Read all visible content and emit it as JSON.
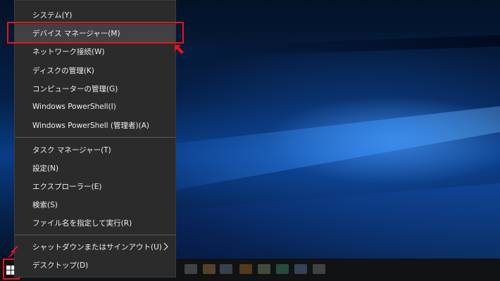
{
  "colors": {
    "menu_background": "#2b2b2b",
    "menu_text": "#f0f0f0",
    "highlight_red": "#e8141c",
    "taskbar": "#101214"
  },
  "context_menu": {
    "items": [
      {
        "label": "システム(Y)"
      },
      {
        "label": "デバイス マネージャー(M)",
        "selected": true
      },
      {
        "label": "ネットワーク接続(W)"
      },
      {
        "label": "ディスクの管理(K)"
      },
      {
        "label": "コンピューターの管理(G)"
      },
      {
        "label": "Windows PowerShell(I)"
      },
      {
        "label": "Windows PowerShell (管理者)(A)"
      },
      {
        "label": "タスク マネージャー(T)"
      },
      {
        "label": "設定(N)"
      },
      {
        "label": "エクスプローラー(E)"
      },
      {
        "label": "検索(S)"
      },
      {
        "label": "ファイル名を指定して実行(R)"
      },
      {
        "label": "シャットダウンまたはサインアウト(U)",
        "has_submenu": true
      },
      {
        "label": "デスクトップ(D)"
      }
    ]
  },
  "icons": {
    "start": "windows-logo-icon",
    "submenu": "chevron-right-icon",
    "annotation_arrow": "red-arrow-icon"
  }
}
